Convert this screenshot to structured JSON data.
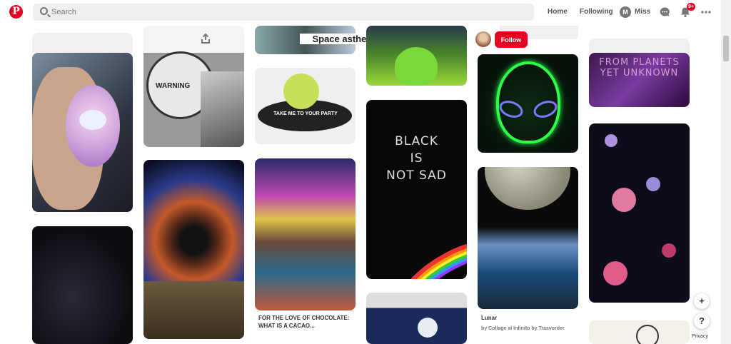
{
  "app": {
    "logo_letter": "P",
    "brand_color": "#e60023"
  },
  "search": {
    "placeholder": "Search",
    "value": ""
  },
  "nav": {
    "home": "Home",
    "following": "Following",
    "user_initial": "M",
    "user_name": "Miss",
    "notification_count": "9+"
  },
  "board": {
    "title": "Space asthetic",
    "follow_label": "Follow"
  },
  "pins": {
    "warning_sign": "WARNING",
    "party_ufo": "TAKE ME TO YOUR PARTY",
    "black_line1": "BLACK",
    "black_line2": "IS",
    "black_line3": "NOT SAD",
    "planets_text": "FROM PLANETS YET UNKNOWN",
    "chocolate_caption": "FOR THE LOVE OF CHOCOLATE: WHAT IS A CACAO...",
    "lunar_title": "Lunar",
    "lunar_by": "by Collage al Infinito by Trasvorder"
  },
  "floating": {
    "add": "+",
    "help": "?",
    "privacy": "Privacy"
  },
  "icons": [
    "pinterest-logo-icon",
    "search-icon",
    "chat-icon",
    "bell-icon",
    "more-icon",
    "share-icon"
  ]
}
